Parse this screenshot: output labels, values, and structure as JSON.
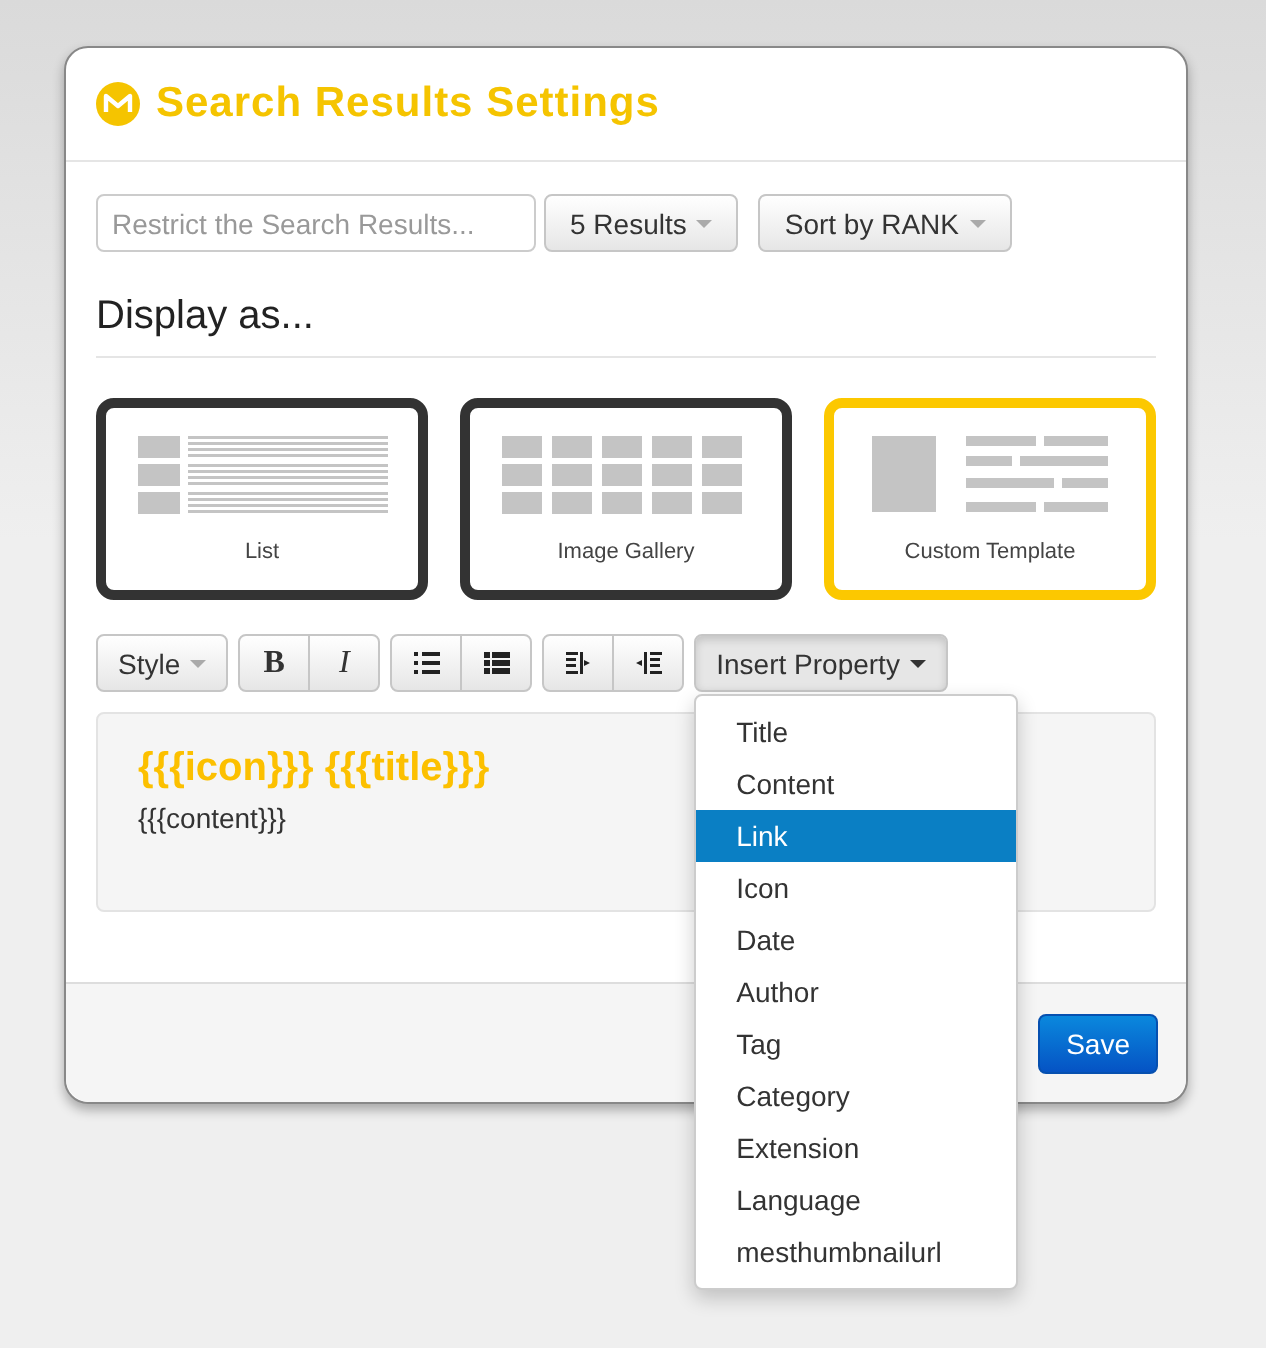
{
  "dialog": {
    "title": "Search Results Settings"
  },
  "filter": {
    "placeholder": "Restrict the Search Results..."
  },
  "count_button": "5 Results",
  "sort_button": "Sort by RANK",
  "display_heading": "Display as...",
  "layouts": [
    {
      "kind": "list",
      "label": "List",
      "selected": false
    },
    {
      "kind": "gallery",
      "label": "Image Gallery",
      "selected": false
    },
    {
      "kind": "custom",
      "label": "Custom Template",
      "selected": true
    }
  ],
  "toolbar": {
    "style_button": "Style",
    "bold_button": "B",
    "italic_button": "I",
    "insert_button": "Insert Property"
  },
  "editor": {
    "title_line": "{{{icon}}} {{{title}}}",
    "body_line": "{{{content}}}"
  },
  "property_menu": [
    {
      "label": "Title",
      "selected": false
    },
    {
      "label": "Content",
      "selected": false
    },
    {
      "label": "Link",
      "selected": true
    },
    {
      "label": "Icon",
      "selected": false
    },
    {
      "label": "Date",
      "selected": false
    },
    {
      "label": "Author",
      "selected": false
    },
    {
      "label": "Tag",
      "selected": false
    },
    {
      "label": "Category",
      "selected": false
    },
    {
      "label": "Extension",
      "selected": false
    },
    {
      "label": "Language",
      "selected": false
    },
    {
      "label": "mesthumbnailurl",
      "selected": false
    }
  ],
  "save_button": "Save"
}
